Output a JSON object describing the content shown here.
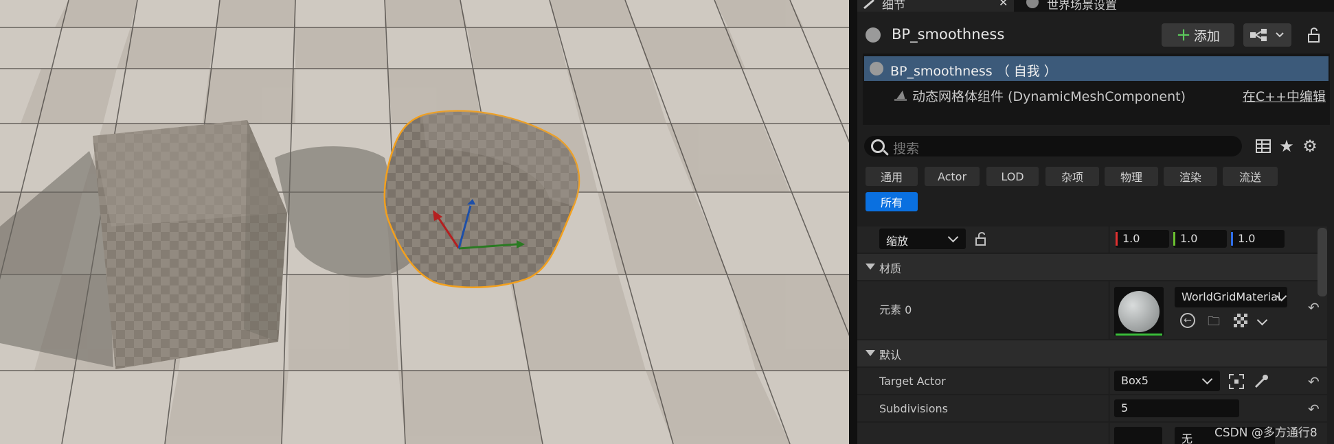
{
  "tabs": {
    "details": "细节",
    "world_settings": "世界场景设置"
  },
  "header": {
    "actor_name": "BP_smoothness",
    "add_button": "添加"
  },
  "components": {
    "root": "BP_smoothness （ 自我 ）",
    "child": "动态网格体组件 (DynamicMeshComponent)",
    "edit_link": "在C++中编辑"
  },
  "search": {
    "placeholder": "搜索"
  },
  "filters": [
    "通用",
    "Actor",
    "LOD",
    "杂项",
    "物理",
    "渲染",
    "流送",
    "所有"
  ],
  "active_filter": "所有",
  "transform": {
    "mode": "缩放",
    "x": "1.0",
    "y": "1.0",
    "z": "1.0",
    "colors": {
      "x": "#e03030",
      "y": "#6ac030",
      "z": "#2f6ee8"
    }
  },
  "material_section": {
    "title": "材质",
    "element_label": "元素 0",
    "material": "WorldGridMaterial"
  },
  "default_section": {
    "title": "默认",
    "target_actor_label": "Target Actor",
    "target_actor_value": "Box5",
    "subdivisions_label": "Subdivisions",
    "subdivisions_value": "5",
    "next_combo": "无"
  },
  "icons": [
    "pencil-icon",
    "close-icon",
    "globe-icon",
    "actor-icon",
    "plus-icon",
    "blueprint-icon",
    "lock-icon",
    "search-icon",
    "table-icon",
    "star-icon",
    "gear-icon",
    "reset-icon",
    "browse-icon",
    "find-icon",
    "eyedropper-icon",
    "picker-icon"
  ],
  "watermark": "CSDN @多方通行8"
}
